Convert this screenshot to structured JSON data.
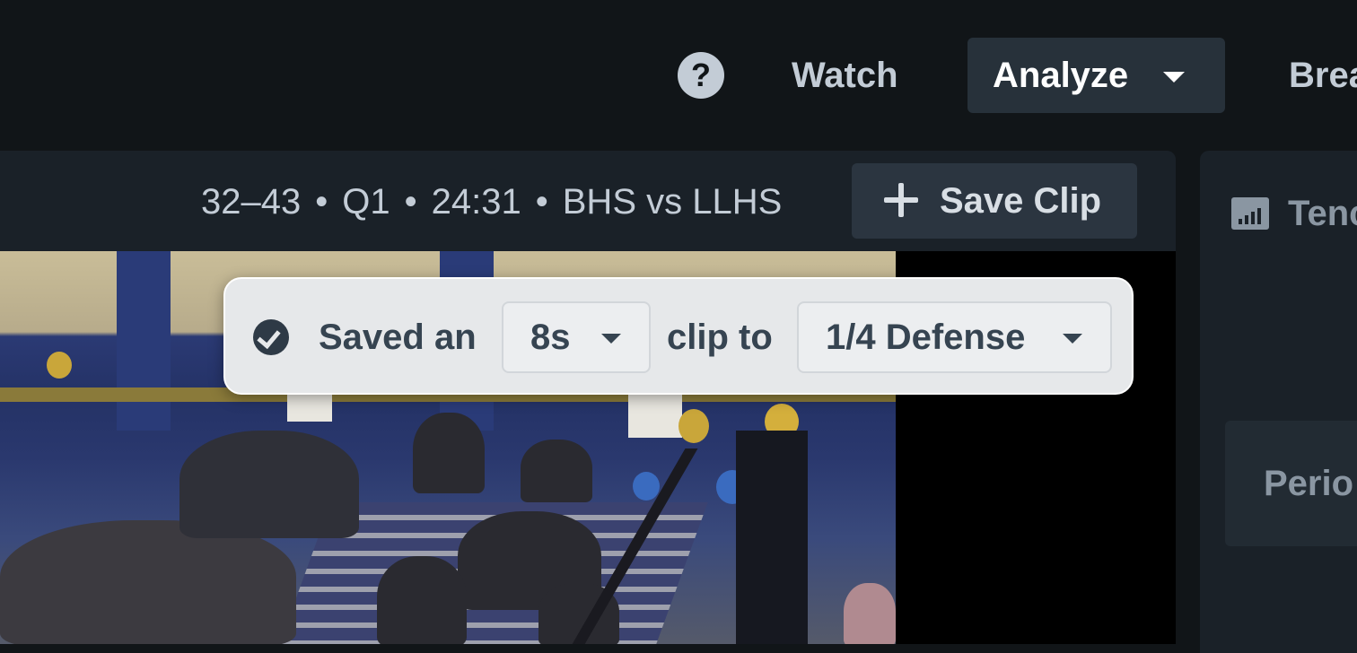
{
  "nav": {
    "help_glyph": "?",
    "watch_label": "Watch",
    "analyze_label": "Analyze",
    "break_label": "Brea"
  },
  "video_header": {
    "score": "32–43",
    "period": "Q1",
    "time": "24:31",
    "matchup": "BHS vs LLHS",
    "save_clip_label": "Save Clip"
  },
  "toast": {
    "prefix": "Saved an",
    "duration_value": "8s",
    "middle": "clip to",
    "playlist_value": "1/4 Defense"
  },
  "side_panel": {
    "title": "Tenc",
    "period_label": "Perio"
  },
  "colors": {
    "background": "#111518",
    "panel": "#1a2128",
    "button": "#2b3540",
    "toast_bg": "#e6e8ea",
    "text_light": "#c3ccd6",
    "text_dark": "#364451"
  },
  "icons": [
    "help-icon",
    "caret-down-icon",
    "plus-icon",
    "check-circle-icon",
    "bar-chart-icon"
  ]
}
